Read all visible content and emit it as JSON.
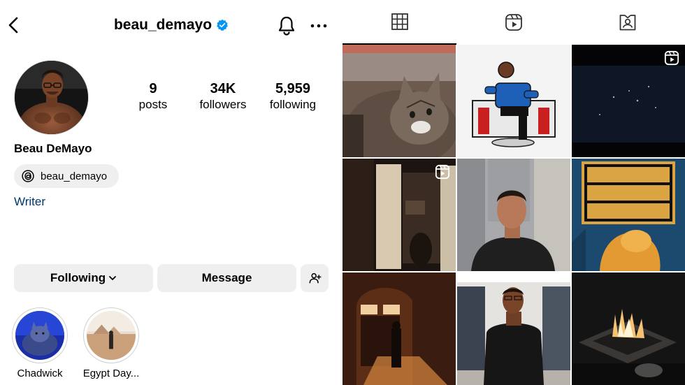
{
  "header": {
    "username": "beau_demayo",
    "icons": {
      "back": "back-arrow-icon",
      "verified": "verified-badge-icon",
      "notifications": "bell-icon",
      "more": "more-dots-icon"
    }
  },
  "profile": {
    "avatar_icon": "profile-avatar",
    "full_name": "Beau DeMayo",
    "threads_handle": "beau_demayo",
    "bio": "Writer",
    "stats": {
      "posts_count": "9",
      "posts_label": "posts",
      "followers_count": "34K",
      "followers_label": "followers",
      "following_count": "5,959",
      "following_label": "following"
    }
  },
  "actions": {
    "following_label": "Following",
    "message_label": "Message"
  },
  "highlights": [
    {
      "label": "Chadwick"
    },
    {
      "label": "Egypt Day..."
    }
  ],
  "tabs": [
    "grid-icon",
    "reels-icon",
    "tagged-icon"
  ],
  "colors": {
    "link": "#00376b",
    "verified": "#0095f6",
    "button_bg": "#efefef"
  }
}
